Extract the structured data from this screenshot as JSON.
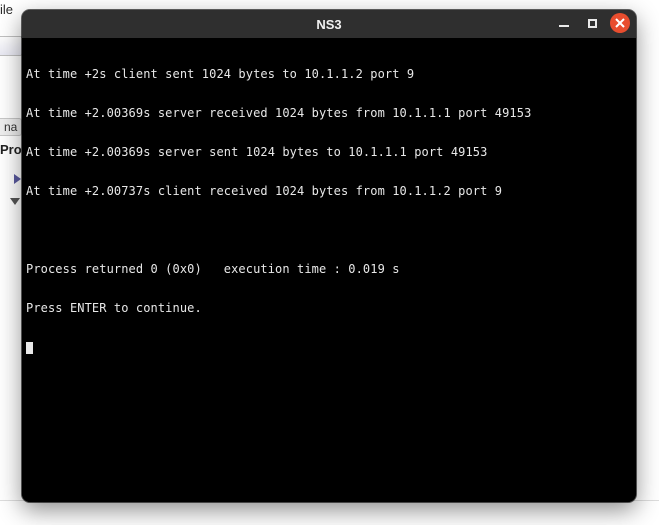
{
  "background": {
    "menu_fragment": "ile",
    "tab_fragment": "na",
    "label_fragment": "Pro"
  },
  "window": {
    "title": "NS3"
  },
  "terminal": {
    "lines": [
      "At time +2s client sent 1024 bytes to 10.1.1.2 port 9",
      "At time +2.00369s server received 1024 bytes from 10.1.1.1 port 49153",
      "At time +2.00369s server sent 1024 bytes to 10.1.1.1 port 49153",
      "At time +2.00737s client received 1024 bytes from 10.1.1.2 port 9",
      "",
      "Process returned 0 (0x0)   execution time : 0.019 s",
      "Press ENTER to continue."
    ]
  }
}
